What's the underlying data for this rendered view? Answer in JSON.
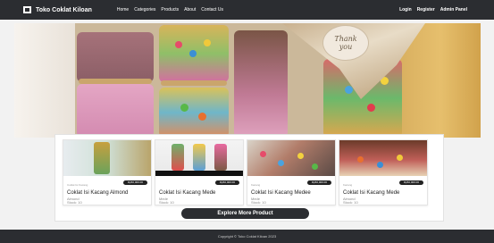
{
  "nav": {
    "brand": "Toko Coklat Kiloan",
    "items": [
      "Home",
      "Categories",
      "Products",
      "About",
      "Contact Us"
    ],
    "right_items": [
      "Login",
      "Register",
      "Admin Panel"
    ]
  },
  "hero": {
    "tag_line1": "Thank",
    "tag_line2": "you"
  },
  "products": [
    {
      "label_top": "Coklat Isi Kacang",
      "price": "Rp50,000.00",
      "title": "Coklat Isi Kacang Almond",
      "category": "Almond",
      "stock": "Stock: 10"
    },
    {
      "label_top": "",
      "price": "Rp50,000.00",
      "title": "Coklat Isi Kacang Mede",
      "category": "Mede",
      "stock": "Stock: 10"
    },
    {
      "label_top": "Kacang",
      "price": "Rp50,000.00",
      "title": "Coklat Isi Kacang Medee",
      "category": "Mede",
      "stock": "Stock: 10"
    },
    {
      "label_top": "Kacang",
      "price": "Rp50,000.00",
      "title": "Coklat Isi Kacang Mede",
      "category": "Almond",
      "stock": "Stock: 10"
    }
  ],
  "explore_label": "Explore More Product",
  "footer": "Copyright © Toko Coklat Kiloan 2023"
}
